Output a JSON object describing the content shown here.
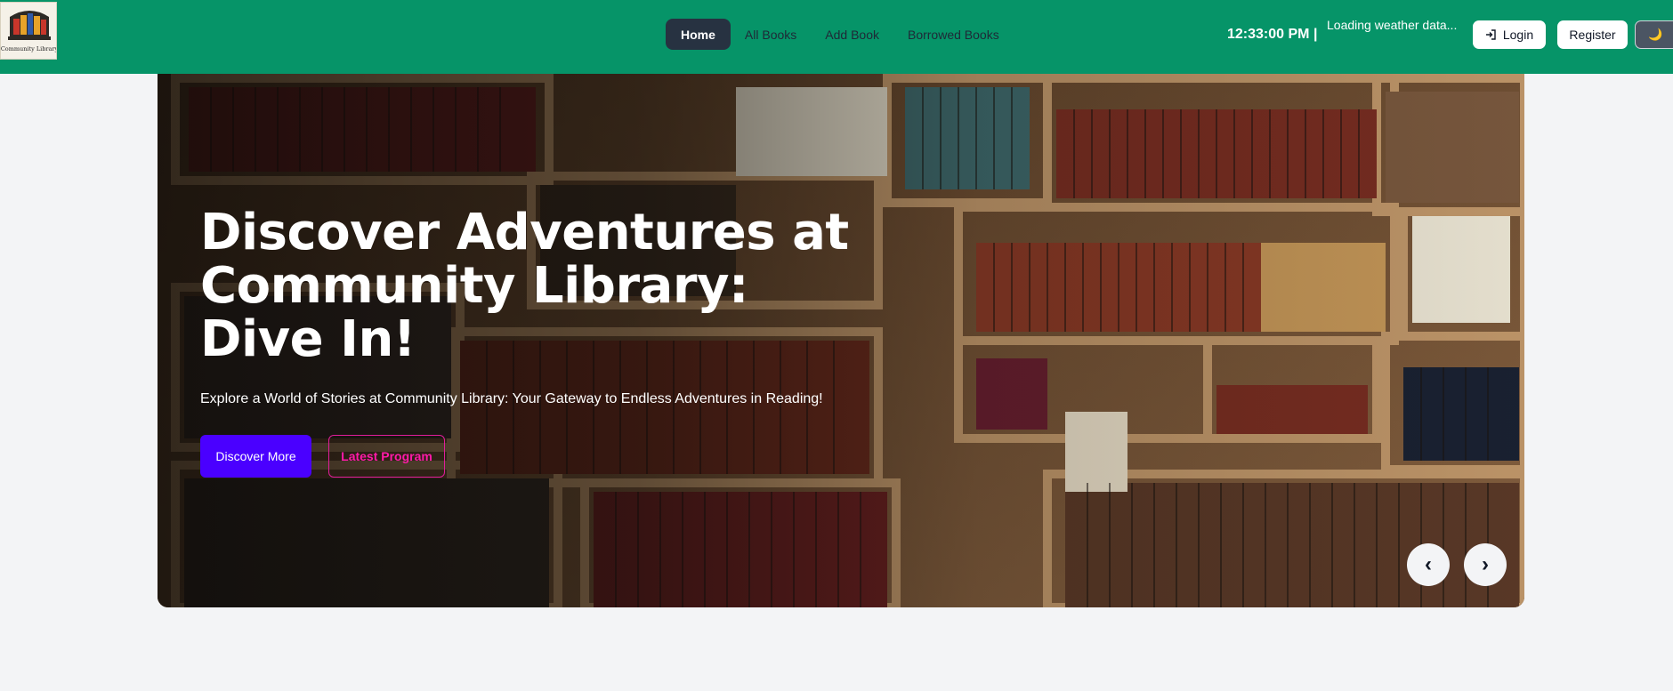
{
  "header": {
    "logo_caption": "Community Library",
    "nav": [
      {
        "label": "Home",
        "active": true
      },
      {
        "label": "All Books",
        "active": false
      },
      {
        "label": "Add Book",
        "active": false
      },
      {
        "label": "Borrowed Books",
        "active": false
      }
    ],
    "clock": "12:33:00 PM |",
    "weather": "Loading weather data...",
    "login_label": "Login",
    "login_icon": "login-icon",
    "register_label": "Register",
    "theme_icon": "moon-icon"
  },
  "hero": {
    "title": "Discover Adventures at Community Library: Dive In!",
    "subtitle": "Explore a World of Stories at Community Library: Your Gateway to Endless Adventures in Reading!",
    "primary_button": "Discover More",
    "secondary_button": "Latest Program",
    "prev_label": "‹",
    "next_label": "›"
  },
  "colors": {
    "navbar": "#069468",
    "active_nav": "#273241",
    "primary_button": "#4a00ff",
    "secondary_accent": "#ff1aa8",
    "page_background": "#f3f4f6"
  }
}
